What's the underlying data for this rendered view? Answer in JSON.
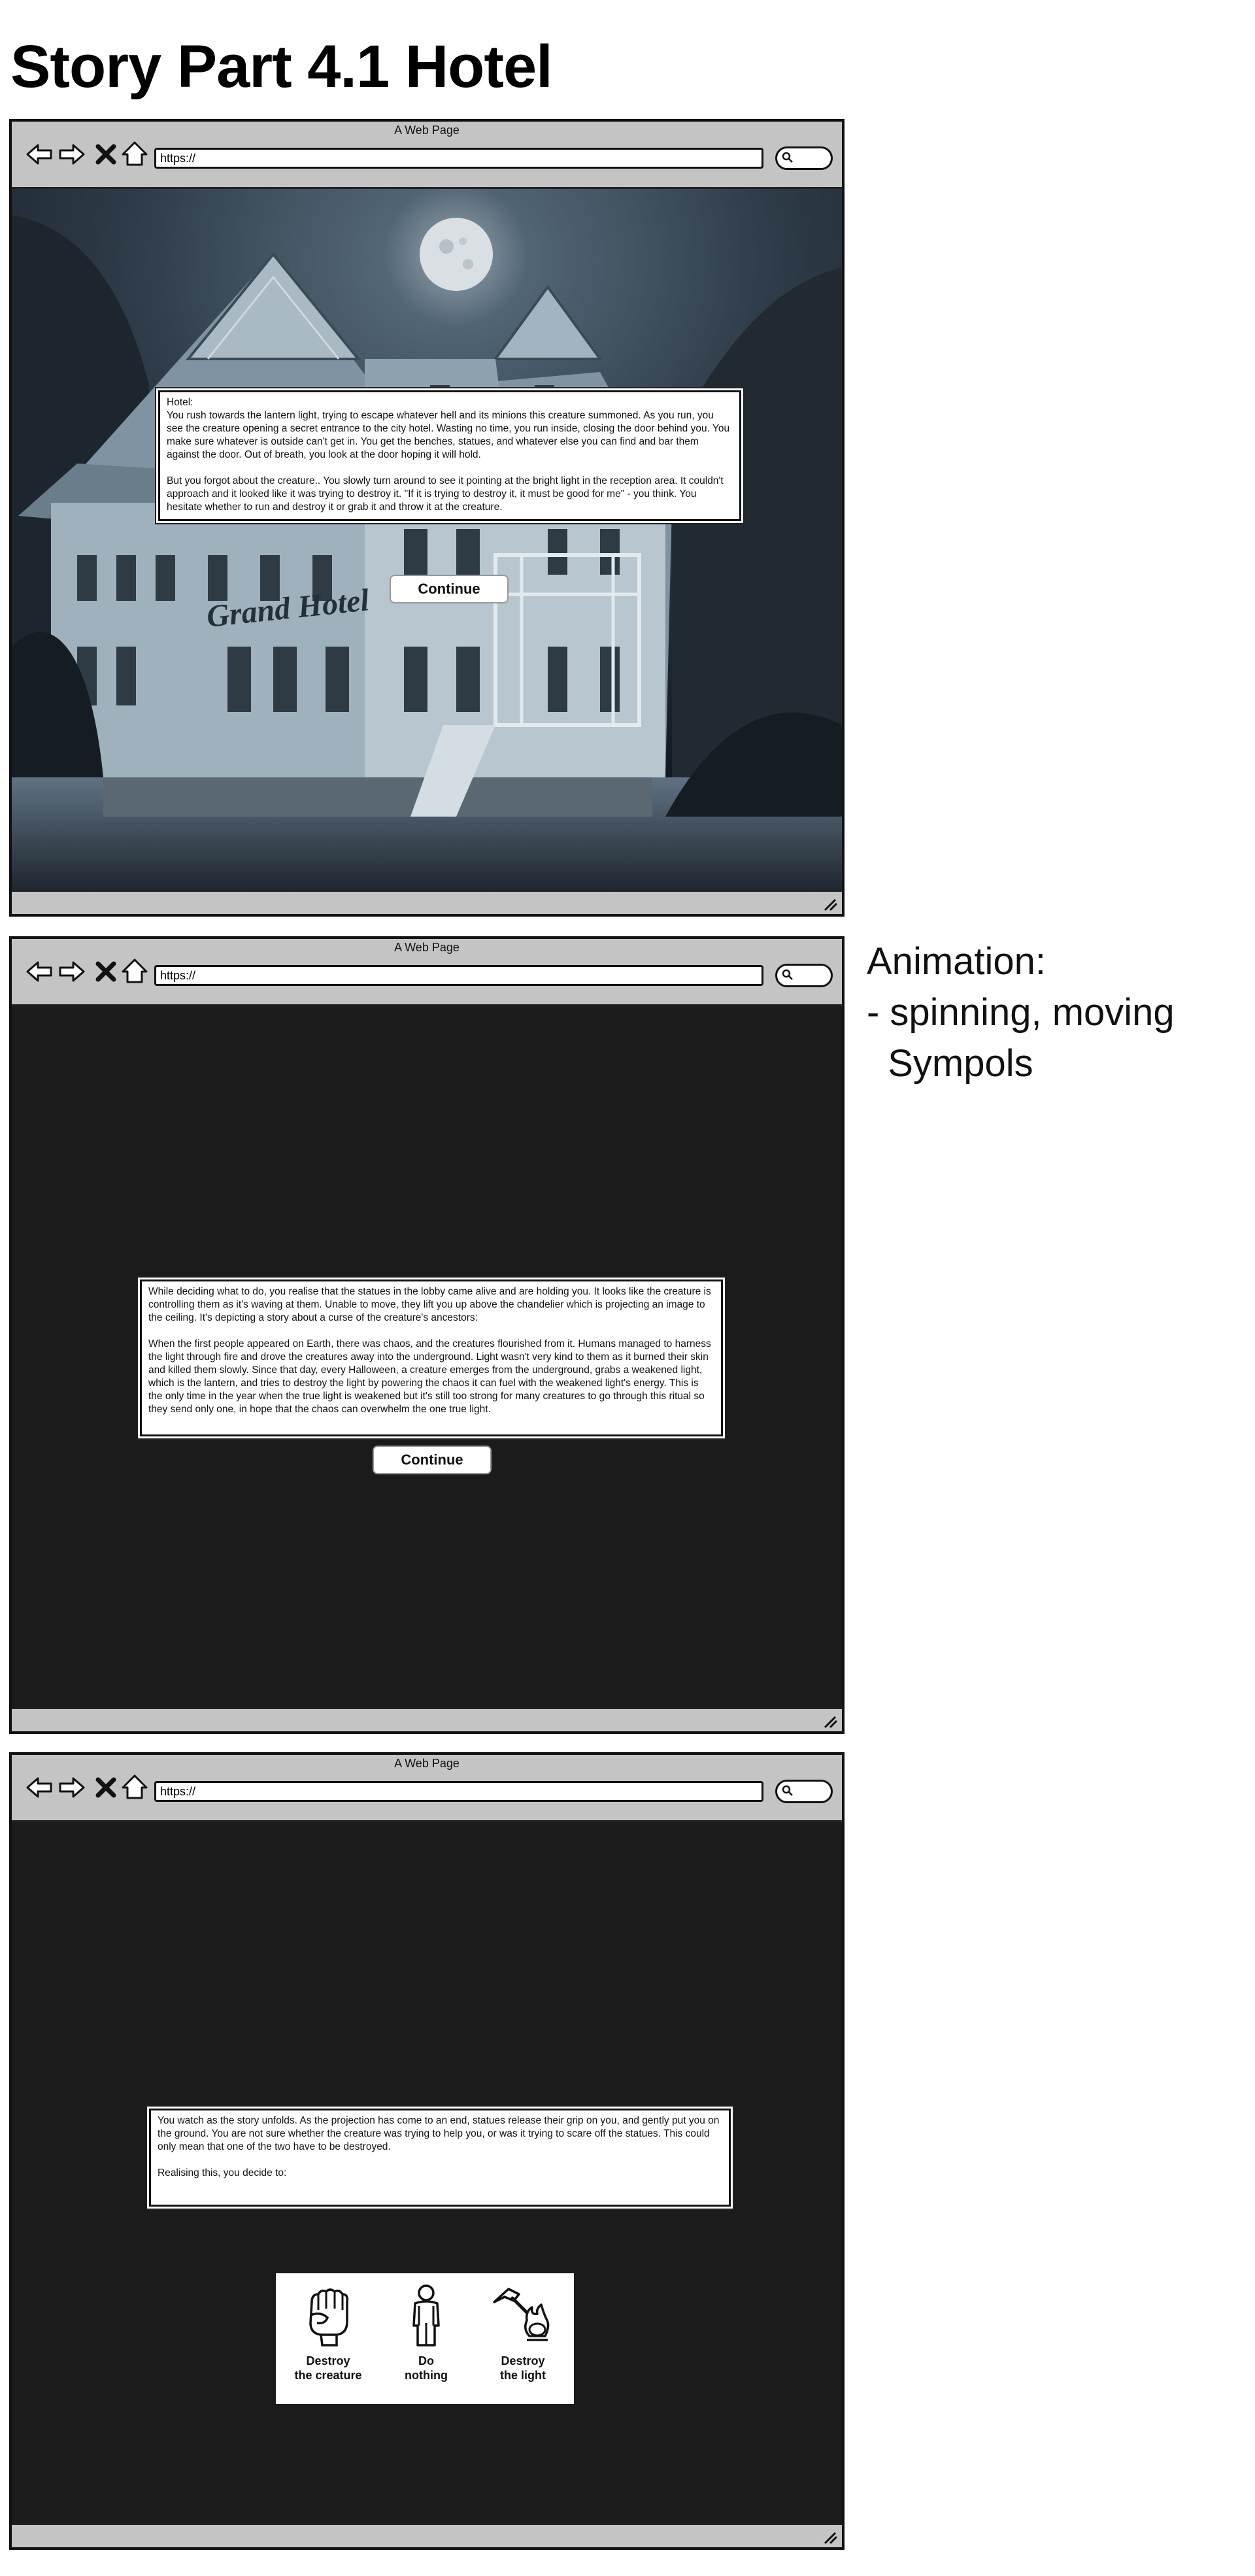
{
  "page_title": "Story Part 4.1 Hotel",
  "side_note": "Animation:\n- spinning, moving\n  Sympols",
  "browser": {
    "window_title": "A Web Page",
    "url": "https://",
    "icons": [
      "back-arrow-icon",
      "forward-arrow-icon",
      "stop-icon",
      "home-icon",
      "search-icon",
      "resize-grip-icon"
    ]
  },
  "screens": [
    {
      "background": "haunted Grand Hotel at night under a full moon",
      "background_sign": "Grand Hotel",
      "text": [
        "Hotel:",
        "You rush towards the lantern light, trying to escape whatever hell and its minions this creature summoned. As you run, you see the creature opening a secret entrance to the city hotel. Wasting no time, you run inside, closing the door behind you. You make sure whatever is outside can't get in. You get the benches, statues, and whatever else you can find and bar them against the door. Out of breath, you look at the door hoping it will hold.",
        "But you forgot about the creature.. You slowly turn around to see it pointing at the bright light in the reception area. It couldn't approach and it looked like it was trying to destroy it. \"If it is trying to destroy it, it must be good for me\" - you think. You hesitate whether to run and destroy it or grab it and throw it at the creature."
      ],
      "button": "Continue"
    },
    {
      "text": [
        "While deciding what to do, you realise that the statues in the lobby came alive and are holding you. It looks like the creature is controlling them as it's waving at them. Unable to move, they lift you up above the chandelier which is projecting an image to the ceiling. It's depicting a story about a curse of the creature's ancestors:",
        "When the first people appeared on Earth, there was chaos, and the creatures flourished from it. Humans managed to harness the light through fire and drove the creatures away into the underground. Light wasn't very kind to them as it burned their skin and killed them slowly. Since that day, every Halloween, a creature emerges from the underground, grabs a weakened light, which is the lantern, and tries to destroy the light by powering the chaos it can fuel with the weakened light's energy. This is the only time in the year when the true light is weakened but it's still too strong for many creatures to go through this ritual so they send only one, in hope that the chaos can overwhelm the one true light."
      ],
      "button": "Continue"
    },
    {
      "text": [
        "You watch as the story unfolds. As the projection has come to an end, statues release their grip on you, and gently put you on the ground. You are not sure whether the creature was trying to help you, or was it trying to scare off the statues. This could only mean that one of the two have to be destroyed.",
        "Realising this, you decide to:"
      ],
      "choices": [
        {
          "label_line1": "Destroy",
          "label_line2": "the creature",
          "icon": "fist-icon"
        },
        {
          "label_line1": "Do",
          "label_line2": "nothing",
          "icon": "standing-person-icon"
        },
        {
          "label_line1": "Destroy",
          "label_line2": "the light",
          "icon": "hammer-lantern-icon"
        }
      ]
    }
  ],
  "colors": {
    "chrome": "#c4c4c4",
    "content_bg": "#1b1b1b",
    "night_sky": "#2b3642"
  }
}
